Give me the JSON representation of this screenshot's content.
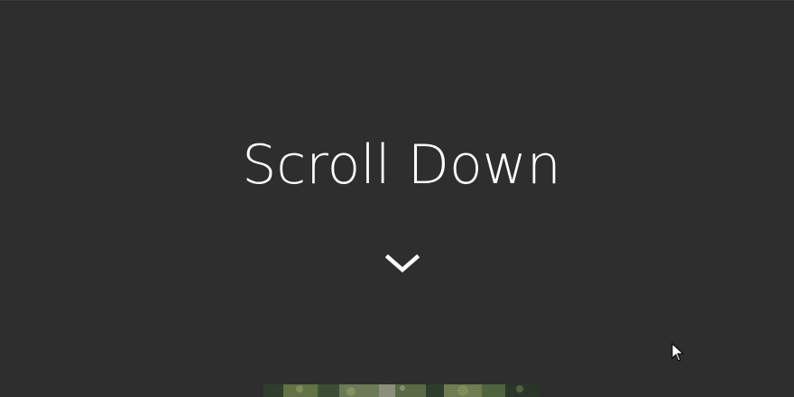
{
  "hero": {
    "title": "Scroll Down"
  },
  "icons": {
    "scroll_indicator": "chevron-down-icon",
    "pointer": "mouse-cursor-icon"
  },
  "colors": {
    "background": "#2e2e2e",
    "text": "#ffffff"
  },
  "image": {
    "kind": "nature-photo-strip"
  }
}
